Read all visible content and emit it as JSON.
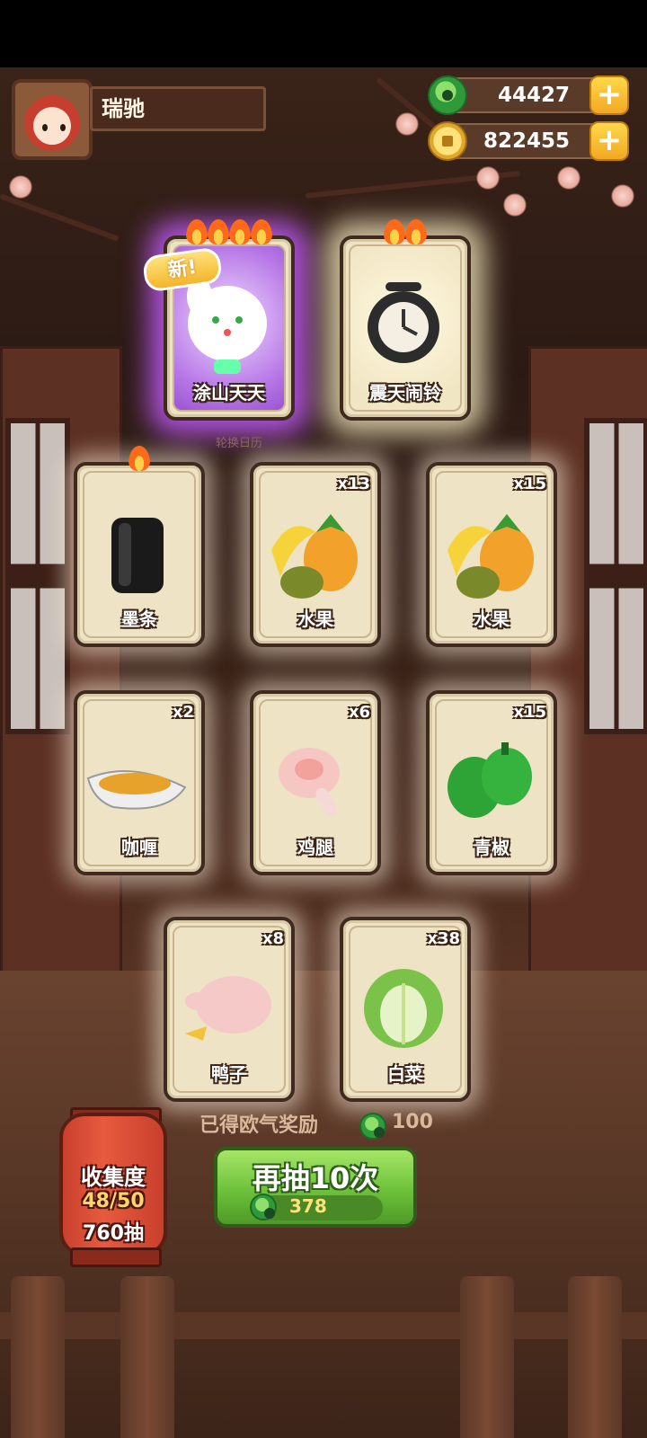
{
  "player": {
    "name": "瑞驰"
  },
  "resources": {
    "jade": "44427",
    "coins": "822455",
    "plus_label": "+"
  },
  "sub_label": "轮换日历",
  "new_label": "新!",
  "cards": [
    {
      "name": "涂山天天",
      "count": "",
      "flames": 4,
      "is_new": true,
      "glow": "purple",
      "icon": "rabbit-character-icon"
    },
    {
      "name": "震天闹铃",
      "count": "",
      "flames": 2,
      "is_new": false,
      "glow": "gold",
      "icon": "alarm-clock-icon"
    },
    {
      "name": "墨条",
      "count": "",
      "flames": 1,
      "is_new": false,
      "glow": "white",
      "icon": "ink-stick-icon"
    },
    {
      "name": "水果",
      "count": "x13",
      "flames": 0,
      "is_new": false,
      "glow": "white",
      "icon": "fruit-icon"
    },
    {
      "name": "水果",
      "count": "x15",
      "flames": 0,
      "is_new": false,
      "glow": "white",
      "icon": "fruit-icon"
    },
    {
      "name": "咖喱",
      "count": "x2",
      "flames": 0,
      "is_new": false,
      "glow": "white",
      "icon": "curry-icon"
    },
    {
      "name": "鸡腿",
      "count": "x6",
      "flames": 0,
      "is_new": false,
      "glow": "white",
      "icon": "chicken-leg-icon"
    },
    {
      "name": "青椒",
      "count": "x15",
      "flames": 0,
      "is_new": false,
      "glow": "white",
      "icon": "green-pepper-icon"
    },
    {
      "name": "鸭子",
      "count": "x8",
      "flames": 0,
      "is_new": false,
      "glow": "white",
      "icon": "duck-icon"
    },
    {
      "name": "白菜",
      "count": "x38",
      "flames": 0,
      "is_new": false,
      "glow": "white",
      "icon": "cabbage-icon"
    }
  ],
  "reward": {
    "label": "已得欧气奖励",
    "value": "100"
  },
  "draw_button": {
    "label": "再抽10次",
    "cost": "378"
  },
  "collection": {
    "title": "收集度",
    "progress": "48/50",
    "draws": "760抽"
  },
  "colors": {
    "jade": "#2f9a3a",
    "gold": "#f2a823",
    "button_green": "#6cc13a",
    "lantern_red": "#e75a3f"
  }
}
